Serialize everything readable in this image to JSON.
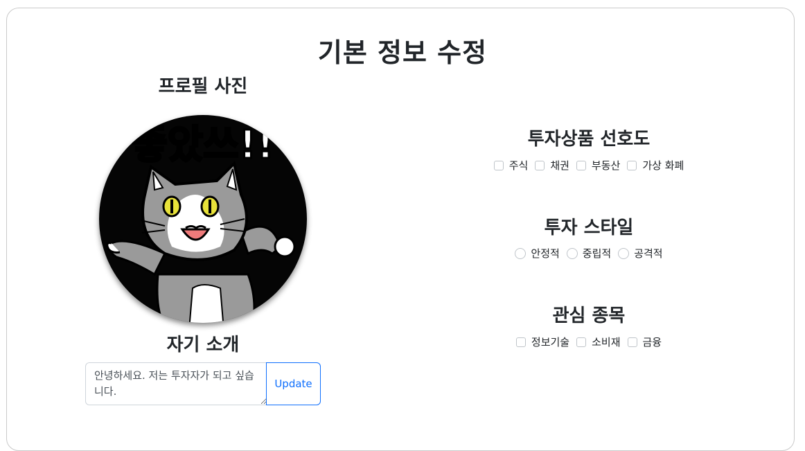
{
  "page": {
    "title": "기본 정보 수정"
  },
  "profile": {
    "title": "프로필 사진",
    "image_caption": "좋았쓰!!"
  },
  "intro": {
    "title": "자기 소개",
    "text": "안녕하세요. 저는 투자자가 되고 싶습니다.",
    "update_label": "Update"
  },
  "investment_products": {
    "title": "투자상품 선호도",
    "options": [
      "주식",
      "채권",
      "부동산",
      "가상 화폐"
    ]
  },
  "investment_style": {
    "title": "투자 스타일",
    "options": [
      "안정적",
      "중립적",
      "공격적"
    ]
  },
  "interests": {
    "title": "관심 종목",
    "options": [
      "정보기술",
      "소비재",
      "금융"
    ]
  },
  "colors": {
    "primary": "#0d6efd",
    "border": "#ced4da",
    "text": "#212529"
  }
}
